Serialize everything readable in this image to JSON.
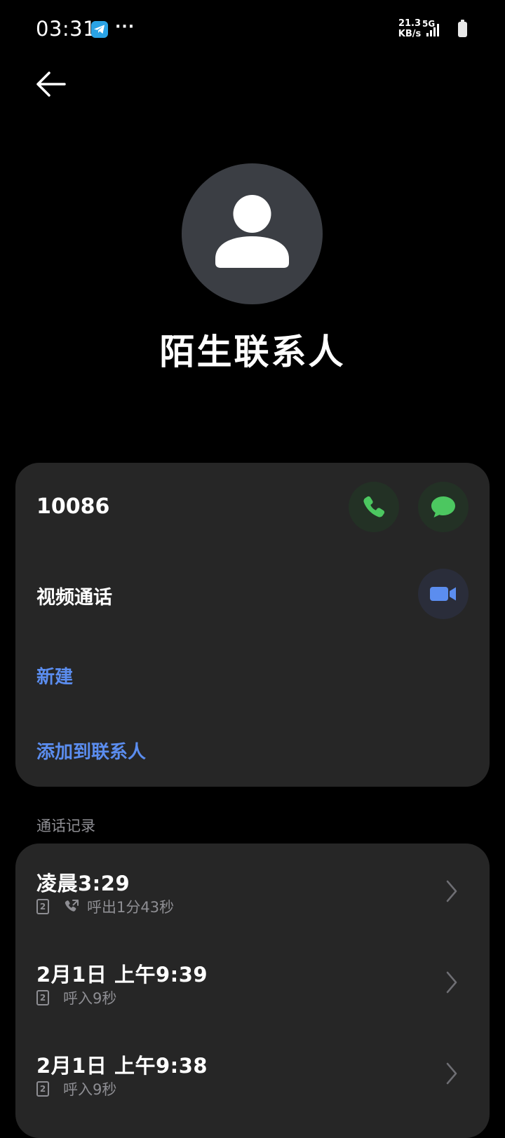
{
  "status_bar": {
    "time": "03:31",
    "more": "···",
    "speed_value": "21.3",
    "speed_unit": "KB/s",
    "network": "5G",
    "icons": [
      "telegram-icon",
      "signal-icon",
      "battery-icon"
    ]
  },
  "header": {
    "back_icon": "back-arrow-icon"
  },
  "contact": {
    "avatar_icon": "person-icon",
    "name": "陌生联系人"
  },
  "number_card": {
    "number": "10086",
    "call_icon": "phone-icon",
    "message_icon": "message-icon",
    "video_label": "视频通话",
    "video_icon": "video-camera-icon",
    "new_label": "新建",
    "add_label": "添加到联系人"
  },
  "call_log": {
    "section_label": "通话记录",
    "entries": [
      {
        "time": "凌晨3:29",
        "sim": "2",
        "direction_icon": "outgoing-call-icon",
        "detail": "呼出1分43秒"
      },
      {
        "time": "2月1日 上午9:39",
        "sim": "2",
        "detail": "呼入9秒"
      },
      {
        "time": "2月1日 上午9:38",
        "sim": "2",
        "detail": "呼入9秒"
      }
    ]
  },
  "colors": {
    "background": "#000000",
    "card": "#262626",
    "accent_blue": "#5b8def",
    "call_green": "#4cc760",
    "secondary_text": "#8e8e93"
  }
}
